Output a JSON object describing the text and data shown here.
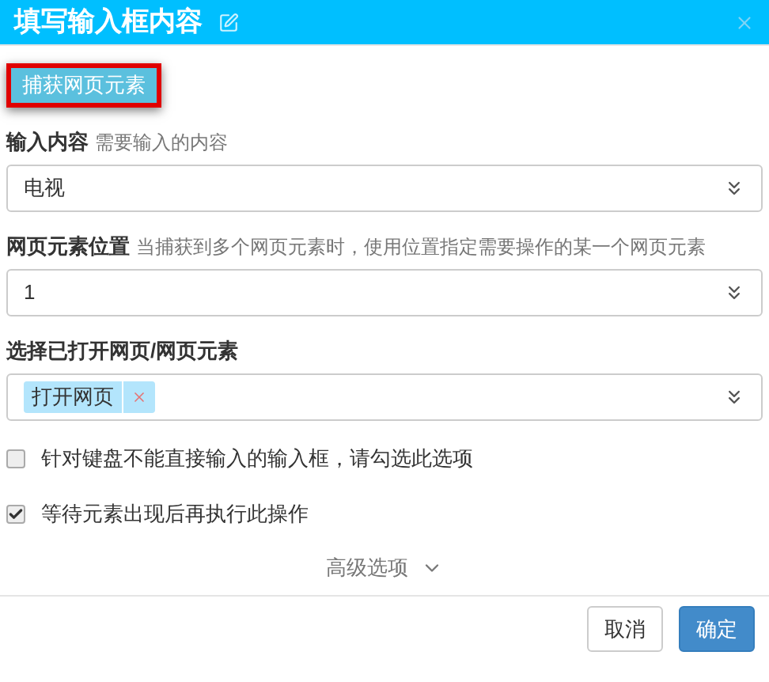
{
  "dialog": {
    "title": "填写输入框内容"
  },
  "capture_button": {
    "label": "捕获网页元素"
  },
  "fields": [
    {
      "label": "输入内容",
      "hint": "需要输入的内容",
      "value": "电视"
    },
    {
      "label": "网页元素位置",
      "hint": "当捕获到多个网页元素时，使用位置指定需要操作的某一个网页元素",
      "value": "1"
    }
  ],
  "page_select": {
    "label": "选择已打开网页/网页元素",
    "tags": [
      "打开网页"
    ]
  },
  "options": [
    {
      "label": "针对键盘不能直接输入的输入框，请勾选此选项",
      "checked": false
    },
    {
      "label": "等待元素出现后再执行此操作",
      "checked": true
    }
  ],
  "advanced": {
    "label": "高级选项",
    "expanded": false
  },
  "buttons": [
    {
      "label": "取消",
      "kind": "secondary"
    },
    {
      "label": "确定",
      "kind": "primary"
    }
  ]
}
